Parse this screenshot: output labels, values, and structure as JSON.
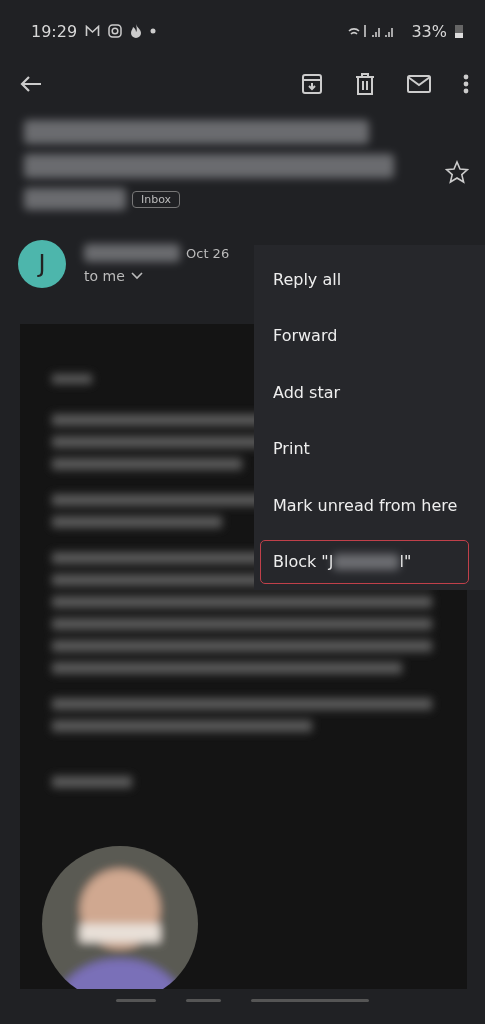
{
  "status_bar": {
    "time": "19:29",
    "battery": "33%"
  },
  "subject": {
    "label": "Inbox"
  },
  "sender": {
    "avatar_letter": "J",
    "date": "Oct 26",
    "recipient": "to me"
  },
  "menu": {
    "items": [
      {
        "kind": "plain",
        "label": "Reply all",
        "highlighted": false
      },
      {
        "kind": "plain",
        "label": "Forward",
        "highlighted": false
      },
      {
        "kind": "plain",
        "label": "Add star",
        "highlighted": false
      },
      {
        "kind": "plain",
        "label": "Print",
        "highlighted": false
      },
      {
        "kind": "plain",
        "label": "Mark unread from here",
        "highlighted": false
      },
      {
        "kind": "redacted",
        "label_start": "Block \"J",
        "label_end": "l\"",
        "highlighted": true
      }
    ]
  }
}
